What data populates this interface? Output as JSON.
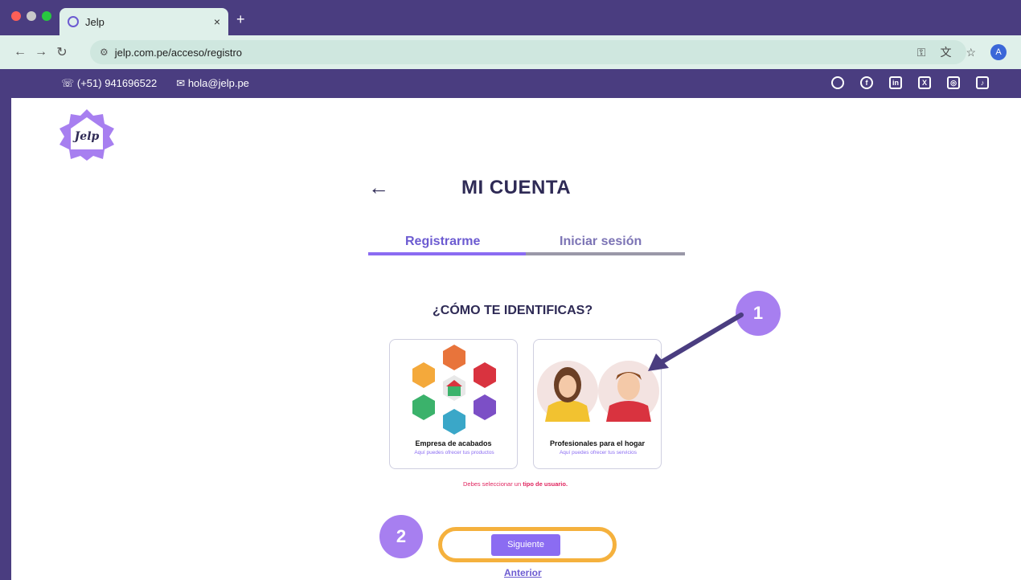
{
  "browser": {
    "tab_title": "Jelp",
    "tab_close": "×",
    "new_tab": "+",
    "url": "jelp.com.pe/acceso/registro",
    "profile_initial": "A"
  },
  "topbar": {
    "phone": "(+51) 941696522",
    "email": "hola@jelp.pe",
    "social_icons": [
      "whatsapp-icon",
      "facebook-icon",
      "linkedin-icon",
      "x-icon",
      "instagram-icon",
      "tiktok-icon"
    ]
  },
  "logo_text": "Jelp",
  "page": {
    "heading": "MI CUENTA",
    "tab_register": "Registrarme",
    "tab_login": "Iniciar sesión",
    "question": "¿CÓMO TE IDENTIFICAS?",
    "card1_title": "Empresa de acabados",
    "card1_sub": "Aquí puedes ofrecer tus productos",
    "card2_title": "Profesionales para el hogar",
    "card2_sub": "Aquí puedes ofrecer tus servicios",
    "error_pre": "Debes seleccionar un ",
    "error_bold": "tipo de usuario.",
    "next": "Siguiente",
    "prev": "Anterior"
  },
  "annotations": {
    "badge1": "1",
    "badge2": "2"
  },
  "colors": {
    "frame": "#4a3d80",
    "accent": "#8b6cf2",
    "highlight": "#f5b13d",
    "error": "#e0245e"
  }
}
